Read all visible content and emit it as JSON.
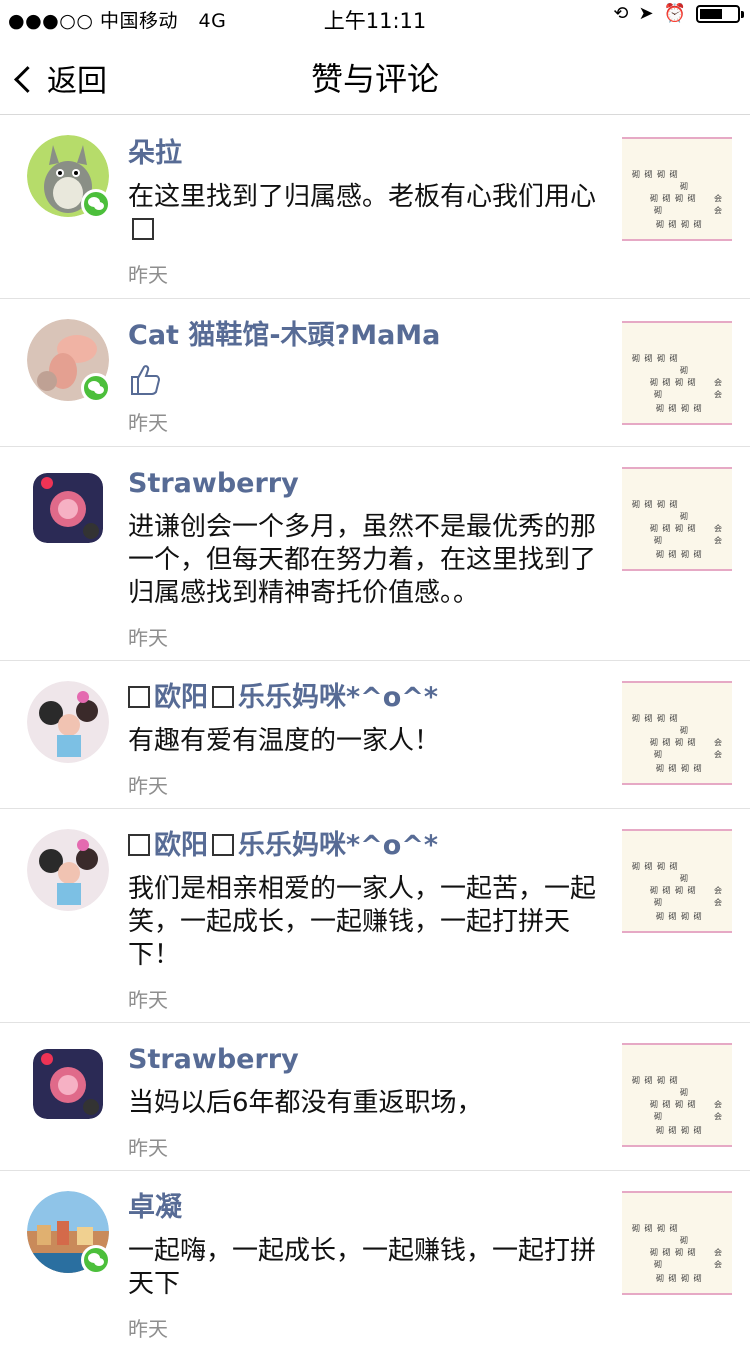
{
  "status_bar": {
    "signal": "●●●○○",
    "carrier": "中国移动",
    "network": "4G",
    "time": "上午11:11",
    "battery_level": 0.6
  },
  "nav": {
    "back_label": "返回",
    "title": "赞与评论"
  },
  "thumb_text": {
    "a": "砌 砌 砌 砌",
    "b": "砌",
    "c": "砌 砌 砌 砌",
    "d": "砌",
    "e": "砌 砌 砌 砌",
    "f": "会",
    "g": "会"
  },
  "items": [
    {
      "name": "朵拉",
      "text": "在这里找到了归属感。老板有心我们用心",
      "has_box": true,
      "time": "昨天"
    },
    {
      "name": "Cat 猫鞋馆-木頭?MaMa",
      "like": true,
      "time": "昨天"
    },
    {
      "name": "Strawberry",
      "text": "进谦创会一个多月，虽然不是最优秀的那一个，但每天都在努力着，在这里找到了归属感找到精神寄托价值感。。",
      "time": "昨天"
    },
    {
      "name_parts": [
        "欧阳",
        "乐乐妈咪*^o^*"
      ],
      "text": "有趣有爱有温度的一家人！",
      "time": "昨天"
    },
    {
      "name_parts": [
        "欧阳",
        "乐乐妈咪*^o^*"
      ],
      "text": "我们是相亲相爱的一家人，一起苦，一起笑，一起成长，一起赚钱，一起打拼天下！",
      "time": "昨天"
    },
    {
      "name": "Strawberry",
      "text": "当妈以后6年都没有重返职场，",
      "time": "昨天"
    },
    {
      "name": "卓凝",
      "text": "一起嗨，一起成长，一起赚钱，一起打拼天下",
      "time": "昨天"
    }
  ]
}
